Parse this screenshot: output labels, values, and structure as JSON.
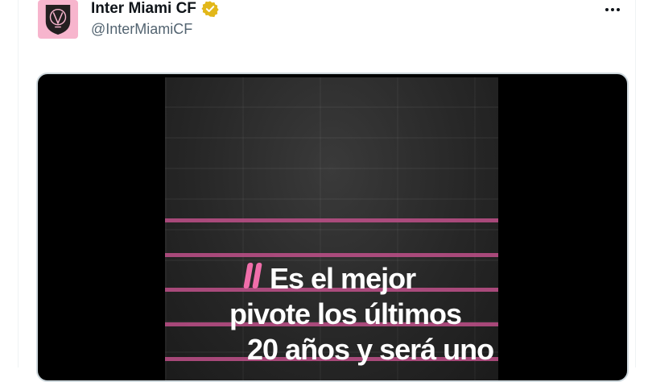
{
  "tweet": {
    "display_name": "Inter Miami CF",
    "handle": "@InterMiamiCF",
    "avatar_icon": "inter-miami-crest-icon",
    "verified_icon": "verified-badge-icon",
    "more_icon": "more-options-icon",
    "brand_pink": "#f7b5cd",
    "verified_color": "#e2b719"
  },
  "media": {
    "quote_lines": [
      "Es el mejor",
      "pivote los últimos",
      "20 años y será uno"
    ],
    "stripe_color": "#c0508a",
    "quote_mark_color": "#f06eaa"
  }
}
